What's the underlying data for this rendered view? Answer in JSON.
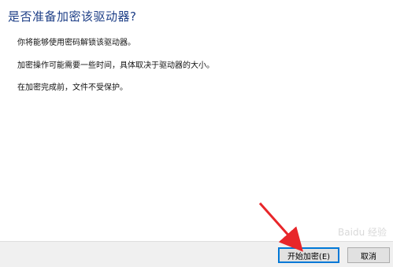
{
  "dialog": {
    "title": "是否准备加密该驱动器?",
    "messages": [
      "你将能够使用密码解锁该驱动器。",
      "加密操作可能需要一些时间，具体取决于驱动器的大小。",
      "在加密完成前，文件不受保护。"
    ]
  },
  "buttons": {
    "start_label": "开始加密(E)",
    "cancel_label": "取消"
  },
  "annotation": {
    "arrow_color": "#e8262a"
  },
  "watermark": "Baidu 经验"
}
